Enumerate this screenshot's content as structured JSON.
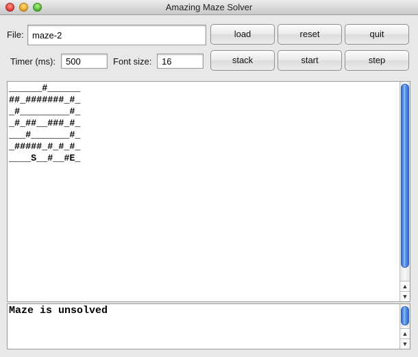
{
  "window": {
    "title": "Amazing Maze Solver"
  },
  "controls": {
    "file_label": "File:",
    "file_value": "maze-2",
    "timer_label": "Timer (ms):",
    "timer_value": "500",
    "font_label": "Font size:",
    "font_value": "16",
    "buttons": {
      "load": "load",
      "reset": "reset",
      "quit": "quit",
      "stack": "stack",
      "start": "start",
      "step": "step"
    }
  },
  "maze": {
    "rows": [
      "______#______",
      "##_#######_#_",
      "_#_________#_",
      "_#_##__###_#_",
      "___#_______#_",
      "_#####_#_#_#_",
      "____S__#__#E_"
    ]
  },
  "status": {
    "text": "Maze is unsolved"
  },
  "icons": {
    "scroll_up": "▲",
    "scroll_down": "▼"
  }
}
